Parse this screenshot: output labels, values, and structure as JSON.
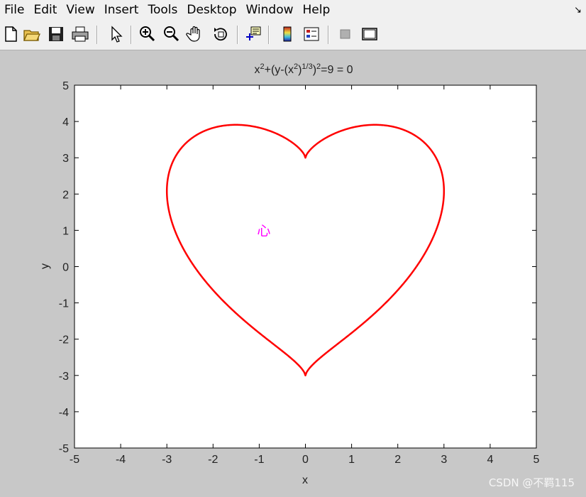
{
  "menubar": {
    "items": [
      "File",
      "Edit",
      "View",
      "Insert",
      "Tools",
      "Desktop",
      "Window",
      "Help"
    ]
  },
  "toolbar": {
    "buttons": [
      {
        "name": "new-figure-icon"
      },
      {
        "name": "open-file-icon"
      },
      {
        "name": "save-figure-icon"
      },
      {
        "name": "print-figure-icon"
      },
      {
        "name": "edit-plot-arrow-icon"
      },
      {
        "name": "zoom-in-icon"
      },
      {
        "name": "zoom-out-icon"
      },
      {
        "name": "pan-hand-icon"
      },
      {
        "name": "rotate-3d-icon"
      },
      {
        "name": "data-cursor-icon"
      },
      {
        "name": "insert-colorbar-icon"
      },
      {
        "name": "insert-legend-icon"
      },
      {
        "name": "hide-plot-tools-icon"
      },
      {
        "name": "show-plot-tools-icon"
      }
    ]
  },
  "watermark": "CSDN @不羁115",
  "chart_data": {
    "type": "line",
    "title": "x²+(y-(x²)^(1/3))²=9 = 0",
    "title_parts": {
      "a": "x",
      "b": "2",
      "c": "+(y-(x",
      "d": "2",
      "e": ")",
      "f": "1/3",
      "g": ")",
      "h": "2",
      "i": "=9 = 0"
    },
    "xlabel": "x",
    "ylabel": "y",
    "xlim": [
      -5,
      5
    ],
    "ylim": [
      -5,
      5
    ],
    "xticks": [
      -5,
      -4,
      -3,
      -2,
      -1,
      0,
      1,
      2,
      3,
      4,
      5
    ],
    "yticks": [
      -5,
      -4,
      -3,
      -2,
      -1,
      0,
      1,
      2,
      3,
      4,
      5
    ],
    "grid": false,
    "series": [
      {
        "equation": "x^2+(y-(x^2)^(1/3))^2=9",
        "color": "#ff0000"
      }
    ],
    "annotations": [
      {
        "text": "心",
        "x": -0.9,
        "y": 1,
        "color": "#ff00ff"
      }
    ]
  }
}
